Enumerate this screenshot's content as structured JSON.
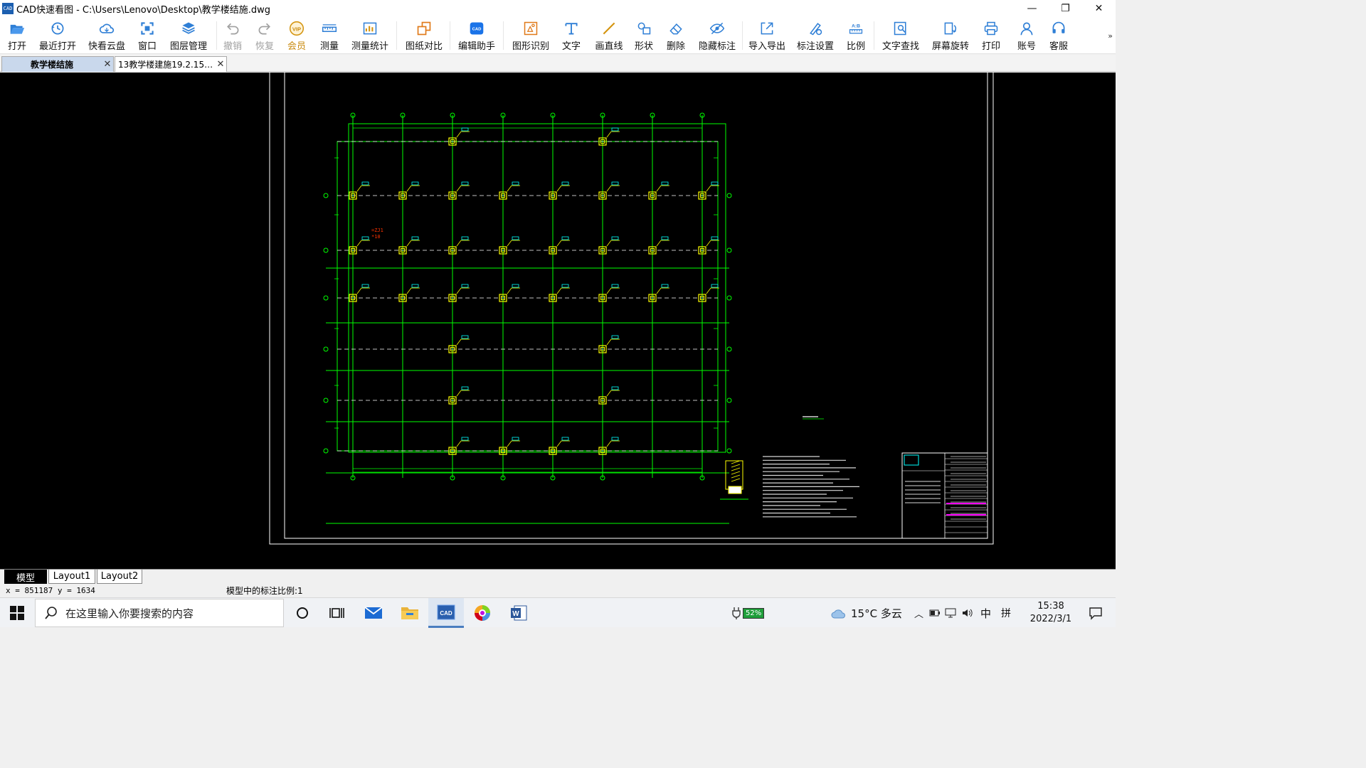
{
  "window": {
    "app_icon_text": "CAD",
    "title": "CAD快速看图 - C:\\Users\\Lenovo\\Desktop\\教学楼结施.dwg",
    "controls": {
      "minimize": "—",
      "restore": "❐",
      "close": "✕"
    }
  },
  "toolbar": {
    "buttons": [
      {
        "label": "打开",
        "icon": "folder-open-icon"
      },
      {
        "label": "最近打开",
        "icon": "recent-clock-icon"
      },
      {
        "label": "快看云盘",
        "icon": "cloud-icon"
      },
      {
        "label": "窗口",
        "icon": "window-frame-icon"
      },
      {
        "label": "图层管理",
        "icon": "layers-icon"
      },
      {
        "label": "撤销",
        "icon": "undo-icon",
        "disabled": true
      },
      {
        "label": "恢复",
        "icon": "redo-icon",
        "disabled": true
      },
      {
        "label": "会员",
        "icon": "vip-badge-icon",
        "vip": true,
        "icon_text": "VIP"
      },
      {
        "label": "测量",
        "icon": "ruler-icon"
      },
      {
        "label": "测量统计",
        "icon": "measure-stats-icon"
      },
      {
        "label": "图纸对比",
        "icon": "compare-icon"
      },
      {
        "label": "编辑助手",
        "icon": "edit-assistant-icon",
        "icon_text": "CAD"
      },
      {
        "label": "图形识别",
        "icon": "shape-recognize-icon"
      },
      {
        "label": "文字",
        "icon": "text-t-icon"
      },
      {
        "label": "画直线",
        "icon": "line-icon"
      },
      {
        "label": "形状",
        "icon": "shapes-icon"
      },
      {
        "label": "删除",
        "icon": "eraser-icon"
      },
      {
        "label": "隐藏标注",
        "icon": "hide-eye-icon"
      },
      {
        "label": "导入导出",
        "icon": "import-export-icon"
      },
      {
        "label": "标注设置",
        "icon": "annotation-settings-icon"
      },
      {
        "label": "比例",
        "icon": "scale-icon",
        "icon_text": "A:B"
      },
      {
        "label": "文字查找",
        "icon": "text-search-icon"
      },
      {
        "label": "屏幕旋转",
        "icon": "screen-rotate-icon"
      },
      {
        "label": "打印",
        "icon": "printer-icon"
      },
      {
        "label": "账号",
        "icon": "user-account-icon"
      },
      {
        "label": "客服",
        "icon": "headset-icon"
      }
    ],
    "more": "»"
  },
  "doc_tabs": [
    {
      "title": "教学楼结施",
      "active": true,
      "close": "✕"
    },
    {
      "title": "13教学楼建施19.2.15…",
      "active": false,
      "close": "✕"
    }
  ],
  "drawing": {
    "red_note": [
      "=ZJ1",
      "*10"
    ],
    "colors": {
      "grid": "#00ff00",
      "column": "#ffff00",
      "dash": "#ffffff",
      "frame": "#ffffff",
      "magenta": "#ff00ff",
      "cyan": "#00ffff",
      "red": "#ff3300"
    }
  },
  "layout_tabs": [
    "模型",
    "Layout1",
    "Layout2"
  ],
  "status": {
    "coords": "x = 851187  y = 1634",
    "scale_note": "模型中的标注比例:1"
  },
  "taskbar": {
    "search_placeholder": "在这里输入你要搜索的内容",
    "apps": [
      {
        "name": "task-view-icon"
      },
      {
        "name": "mail-icon"
      },
      {
        "name": "file-explorer-icon"
      },
      {
        "name": "cad-app-icon",
        "text": "CAD",
        "running": true
      },
      {
        "name": "browser-icon"
      },
      {
        "name": "word-icon",
        "text": "W"
      }
    ],
    "battery": "52%",
    "weather": "15°C 多云",
    "ime": "中",
    "ime2": "拼",
    "time": "15:38",
    "date": "2022/3/1"
  }
}
